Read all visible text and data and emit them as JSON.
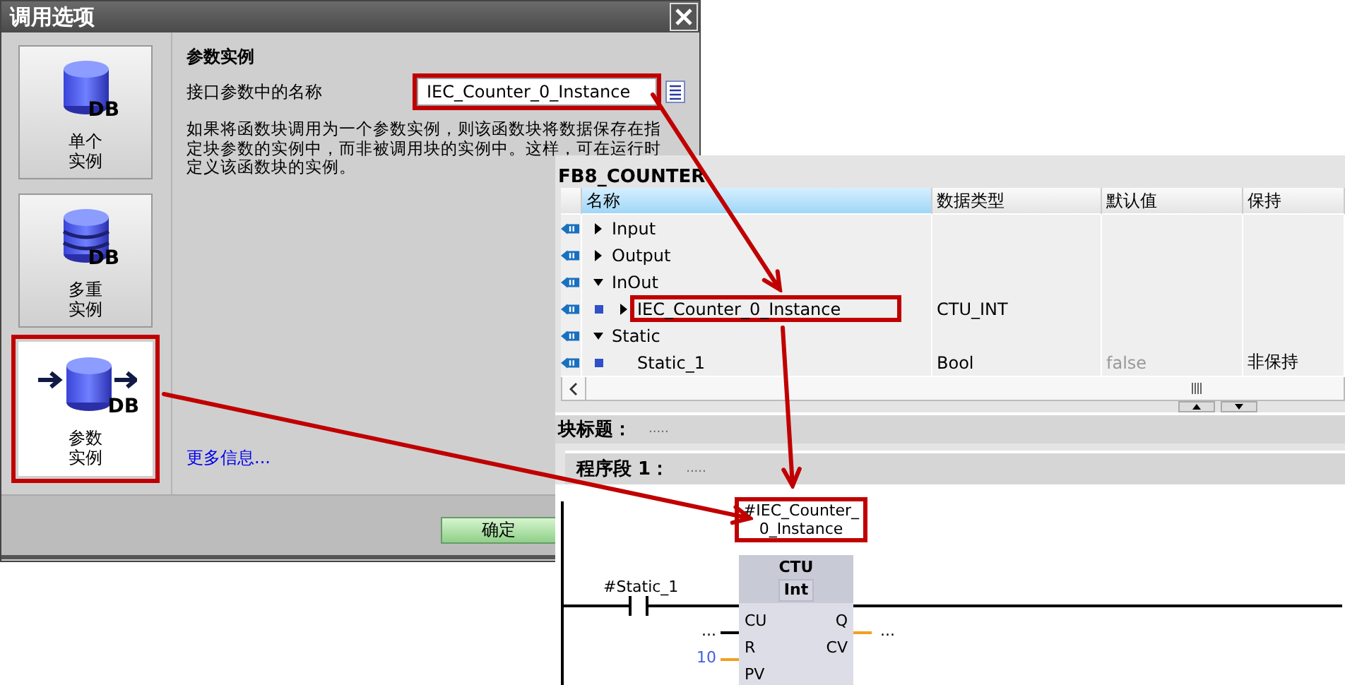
{
  "dialog": {
    "title": "调用选项",
    "options": [
      {
        "kind": "single",
        "badge": "DB",
        "label": [
          "单个",
          "实例"
        ],
        "selected": false,
        "annotated": false
      },
      {
        "kind": "multi",
        "badge": "DB",
        "label": [
          "多重",
          "实例"
        ],
        "selected": false,
        "annotated": false
      },
      {
        "kind": "parameter",
        "badge": "DB",
        "label": [
          "参数",
          "实例"
        ],
        "selected": true,
        "annotated": true
      }
    ],
    "section_title": "参数实例",
    "name_field": {
      "label": "接口参数中的名称",
      "value": "IEC_Counter_0_Instance",
      "annotated": true
    },
    "description": [
      "如果将函数块调用为一个参数实例，则该函数块将数据保存在指",
      "定块参数的实例中，而非被调用块的实例中。这样，可在运行时",
      "定义该函数块的实例。"
    ],
    "more_info_link": "更多信息...",
    "ok_button": "确定"
  },
  "editor": {
    "block_name": "FB8_COUNTER",
    "columns": [
      {
        "label": "名称",
        "selected": true
      },
      {
        "label": "数据类型",
        "selected": false
      },
      {
        "label": "默认值",
        "selected": false
      },
      {
        "label": "保持",
        "selected": false
      }
    ],
    "rows": [
      {
        "name": "Input",
        "expanded": false
      },
      {
        "name": "Output",
        "expanded": false
      },
      {
        "name": "InOut",
        "expanded": true,
        "children": [
          {
            "name": "IEC_Counter_0_Instance",
            "data_type": "CTU_INT",
            "expanded": false,
            "annotated": true
          }
        ]
      },
      {
        "name": "Static",
        "expanded": true,
        "children": [
          {
            "name": "Static_1",
            "data_type": "Bool",
            "default": "false",
            "retain": "非保持"
          }
        ]
      }
    ],
    "block_title": {
      "label": "块标题：",
      "comment": "....."
    },
    "network": {
      "label": "程序段 1：",
      "comment": "....."
    },
    "ladder": {
      "instance": [
        "#IEC_Counter_",
        "0_Instance"
      ],
      "annotated": true,
      "contact": "#Static_1",
      "block": {
        "type": "CTU",
        "data_type": "Int",
        "inputs": [
          {
            "pin": "CU"
          },
          {
            "pin": "R",
            "value": "...",
            "kind": "bool",
            "constant": false
          },
          {
            "pin": "PV",
            "value": "10",
            "kind": "int",
            "constant": true
          }
        ],
        "outputs": [
          {
            "pin": "Q"
          },
          {
            "pin": "CV",
            "value": "...",
            "kind": "int",
            "constant": false
          }
        ]
      }
    }
  }
}
